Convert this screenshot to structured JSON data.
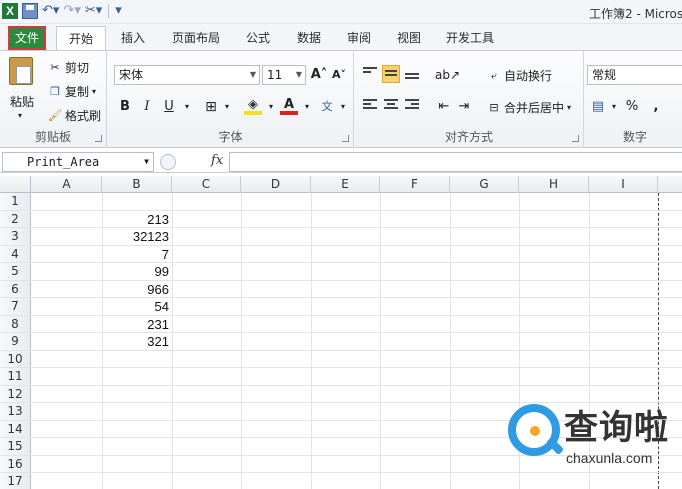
{
  "window": {
    "title": "工作簿2 - Micros"
  },
  "tabs": [
    "文件",
    "开始",
    "插入",
    "页面布局",
    "公式",
    "数据",
    "审阅",
    "视图",
    "开发工具"
  ],
  "clipboard": {
    "paste": "粘贴",
    "cut": "剪切",
    "copy": "复制",
    "format_painter": "格式刷",
    "label": "剪贴板"
  },
  "font": {
    "name": "宋体",
    "size": "11",
    "bold": "B",
    "italic": "I",
    "underline": "U",
    "label": "字体"
  },
  "alignment": {
    "wrap": "自动换行",
    "merge": "合并后居中",
    "label": "对齐方式"
  },
  "number": {
    "format": "常规",
    "percent": "%",
    "comma": ",",
    "label": "数字"
  },
  "formula_bar": {
    "name_box": "Print_Area",
    "fx": "fx",
    "value": ""
  },
  "grid": {
    "columns": [
      "A",
      "B",
      "C",
      "D",
      "E",
      "F",
      "G",
      "H",
      "I"
    ],
    "rows": [
      {
        "num": "1",
        "b": ""
      },
      {
        "num": "2",
        "b": "213"
      },
      {
        "num": "3",
        "b": "32123"
      },
      {
        "num": "4",
        "b": "7"
      },
      {
        "num": "5",
        "b": "99"
      },
      {
        "num": "6",
        "b": "966"
      },
      {
        "num": "7",
        "b": "54"
      },
      {
        "num": "8",
        "b": "231"
      },
      {
        "num": "9",
        "b": "321"
      },
      {
        "num": "10",
        "b": ""
      },
      {
        "num": "11",
        "b": ""
      },
      {
        "num": "12",
        "b": ""
      },
      {
        "num": "13",
        "b": ""
      },
      {
        "num": "14",
        "b": ""
      },
      {
        "num": "15",
        "b": ""
      },
      {
        "num": "16",
        "b": ""
      },
      {
        "num": "17",
        "b": ""
      }
    ]
  },
  "watermark": {
    "cn": "查询啦",
    "en": "chaxunla.com"
  },
  "colors": {
    "file_tab": "#2c8a3f",
    "file_tab_border": "#d23b3b",
    "watermark_blue": "#2f9be5"
  }
}
